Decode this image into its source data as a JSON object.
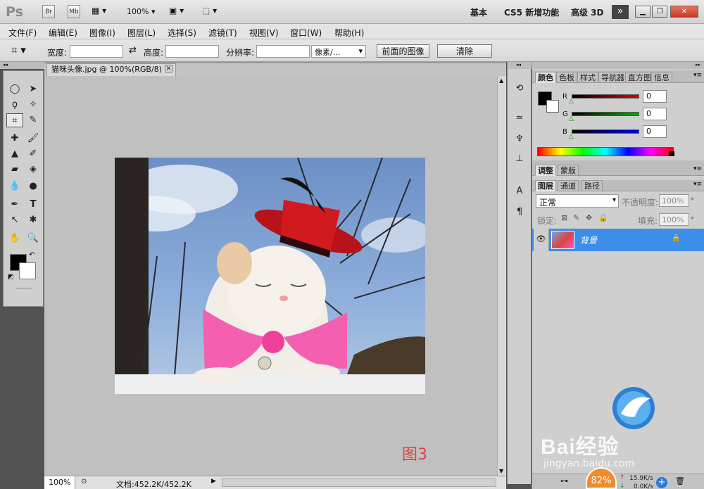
{
  "appbar": {
    "logo": "Ps",
    "br": "Br",
    "mb": "Mb",
    "zoom": "100%",
    "workspaces": [
      "基本",
      "CS5 新增功能",
      "高级 3D"
    ],
    "more": "»"
  },
  "menus": [
    "文件(F)",
    "编辑(E)",
    "图像(I)",
    "图层(L)",
    "选择(S)",
    "滤镜(T)",
    "视图(V)",
    "窗口(W)",
    "帮助(H)"
  ],
  "options": {
    "width_label": "宽度:",
    "height_label": "高度:",
    "resolution_label": "分辨率:",
    "unit_value": "像素/...",
    "front_image": "前面的图像",
    "clear": "清除"
  },
  "document": {
    "tab_title": "猫咪头像.jpg @ 100%(RGB/8)",
    "annotation": "图3"
  },
  "status": {
    "zoom": "100%",
    "doc_size": "文档:452.2K/452.2K"
  },
  "color_panel": {
    "tabs": [
      "颜色",
      "色板",
      "样式",
      "导航器",
      "直方图",
      "信息"
    ],
    "r_label": "R",
    "g_label": "G",
    "b_label": "B",
    "r": "0",
    "g": "0",
    "b": "0",
    "colors": {
      "r": "#e00000",
      "g": "#00b000",
      "b": "#0000e0"
    }
  },
  "adjust_panel": {
    "tabs": [
      "调整",
      "蒙版"
    ]
  },
  "layers_panel": {
    "tabs": [
      "图层",
      "通道",
      "路径"
    ],
    "blend_mode": "正常",
    "opacity_label": "不透明度:",
    "opacity": "100%",
    "lock_label": "锁定:",
    "fill_label": "填充:",
    "fill": "100%",
    "layer_name": "背景"
  },
  "watermark": {
    "brand": "Bai经验",
    "url": "jingyan.baidu.com"
  },
  "net_widget": {
    "percent": "82%",
    "up": "15.9K/s",
    "down": "0.0K/s"
  }
}
